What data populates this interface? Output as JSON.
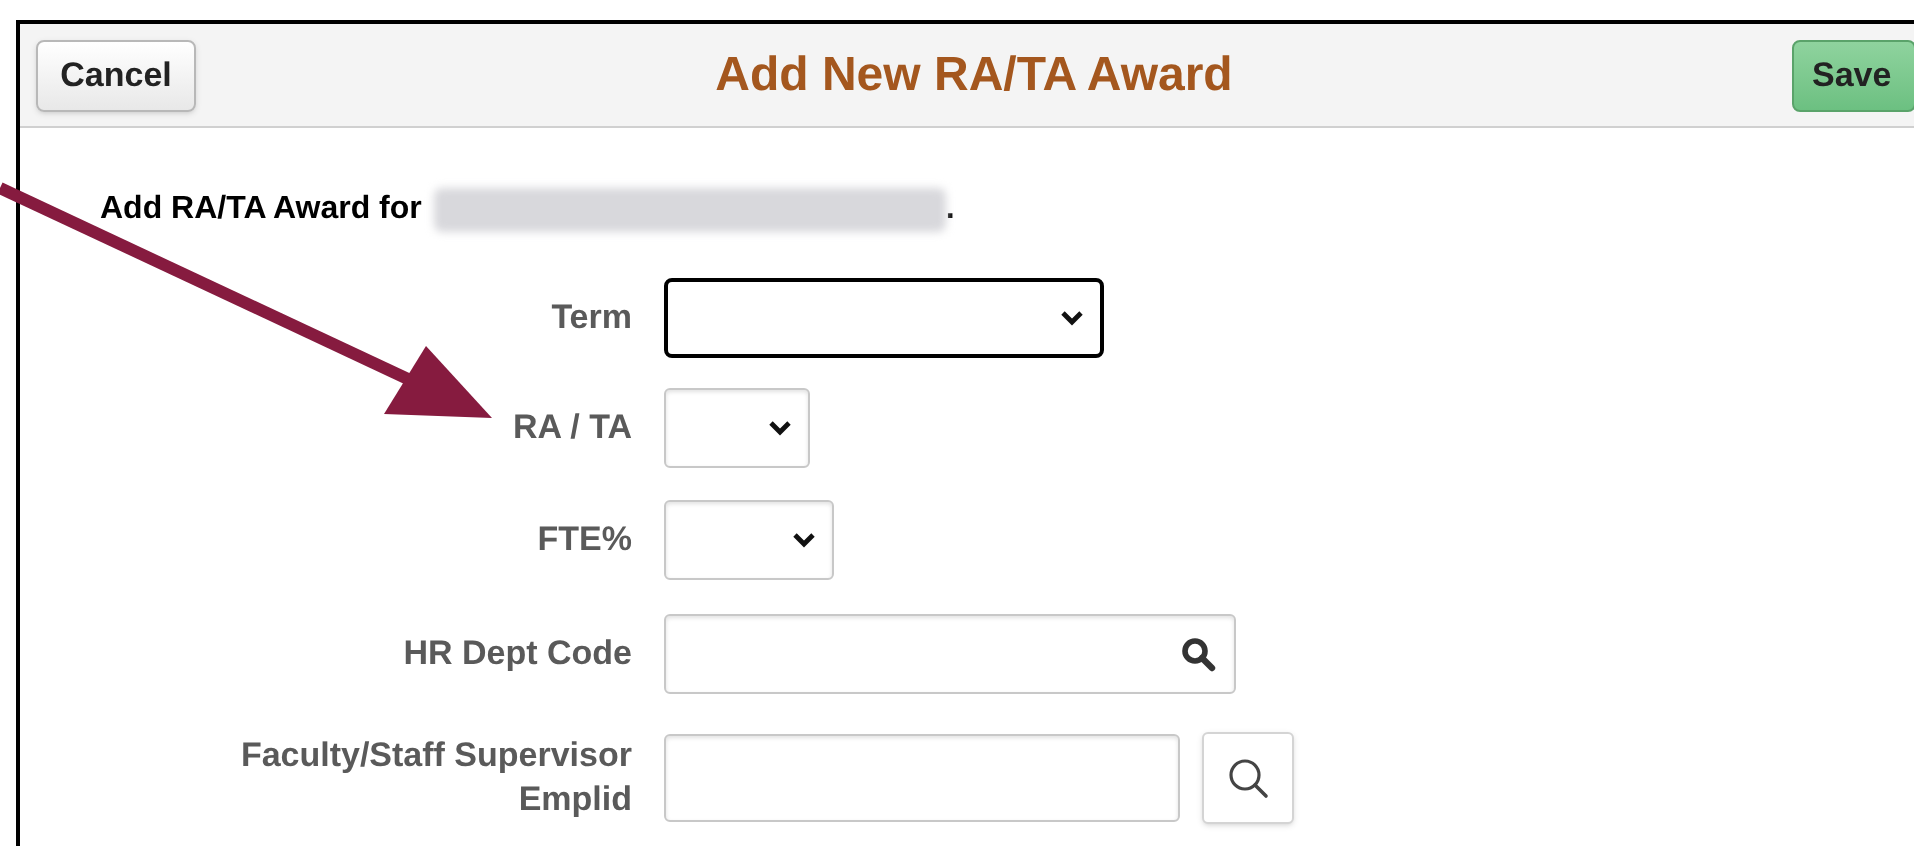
{
  "header": {
    "cancel_button": "Cancel",
    "title": "Add New RA/TA Award",
    "save_button": "Save"
  },
  "intro": {
    "text": "Add RA/TA Award for",
    "redacted_name": true,
    "suffix": "."
  },
  "fields": [
    {
      "label": "Term",
      "kind": "select",
      "focused": true
    },
    {
      "label": "RA / TA",
      "kind": "select",
      "focused": false
    },
    {
      "label": "FTE%",
      "kind": "select",
      "focused": false
    },
    {
      "label": "HR Dept Code",
      "kind": "lookup",
      "focused": false
    },
    {
      "label": "Faculty/Staff Supervisor Emplid",
      "kind": "input-button",
      "focused": false
    }
  ]
}
